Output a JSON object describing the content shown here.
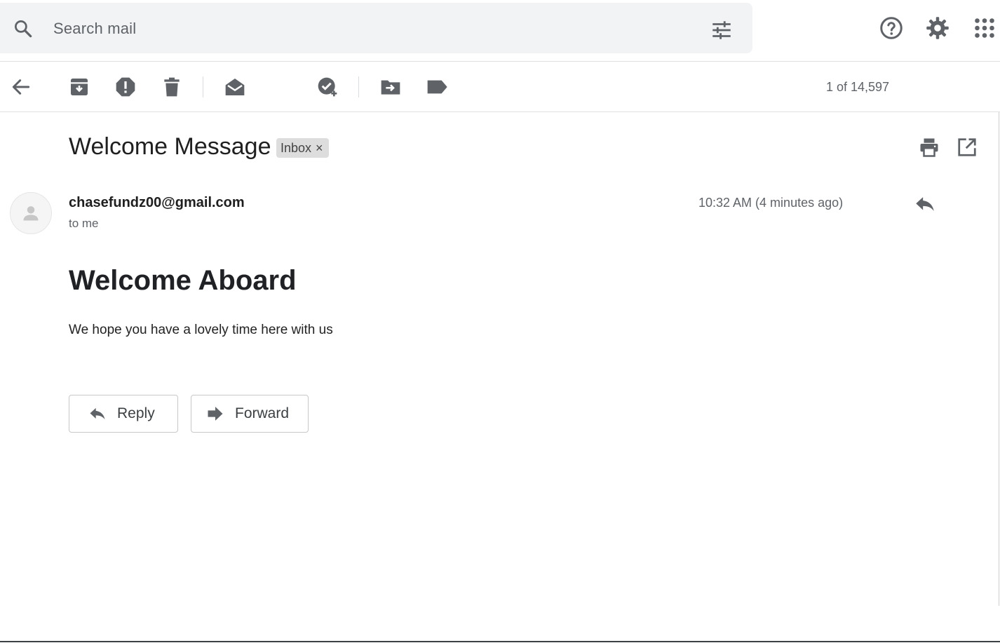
{
  "search": {
    "placeholder": "Search mail"
  },
  "toolbar": {
    "pager": "1 of 14,597"
  },
  "message": {
    "subject": "Welcome Message",
    "label": "Inbox",
    "label_close": "×",
    "sender": "chasefundz00@gmail.com",
    "recipient": "to me",
    "time": "10:32 AM (4 minutes ago)"
  },
  "body": {
    "heading": "Welcome Aboard",
    "text": "We hope you have a lovely time here with us"
  },
  "actions": {
    "reply": "Reply",
    "forward": "Forward"
  },
  "icons": {
    "search": "search-icon",
    "filter": "tune-icon",
    "help": "help-icon",
    "settings": "gear-icon",
    "apps": "apps-grid-icon",
    "back": "arrow-left-icon",
    "archive": "archive-icon",
    "spam": "report-spam-icon",
    "delete": "trash-icon",
    "mark_unread": "mark-unread-icon",
    "add_task": "add-task-icon",
    "move": "move-to-icon",
    "labels": "label-icon",
    "print": "print-icon",
    "new_window": "open-in-new-icon",
    "reply": "reply-icon",
    "forward": "forward-icon",
    "avatar": "person-icon"
  },
  "colors": {
    "icon_gray": "#5f6368",
    "search_bg": "#f1f3f4",
    "chip_bg": "#dddddd"
  }
}
